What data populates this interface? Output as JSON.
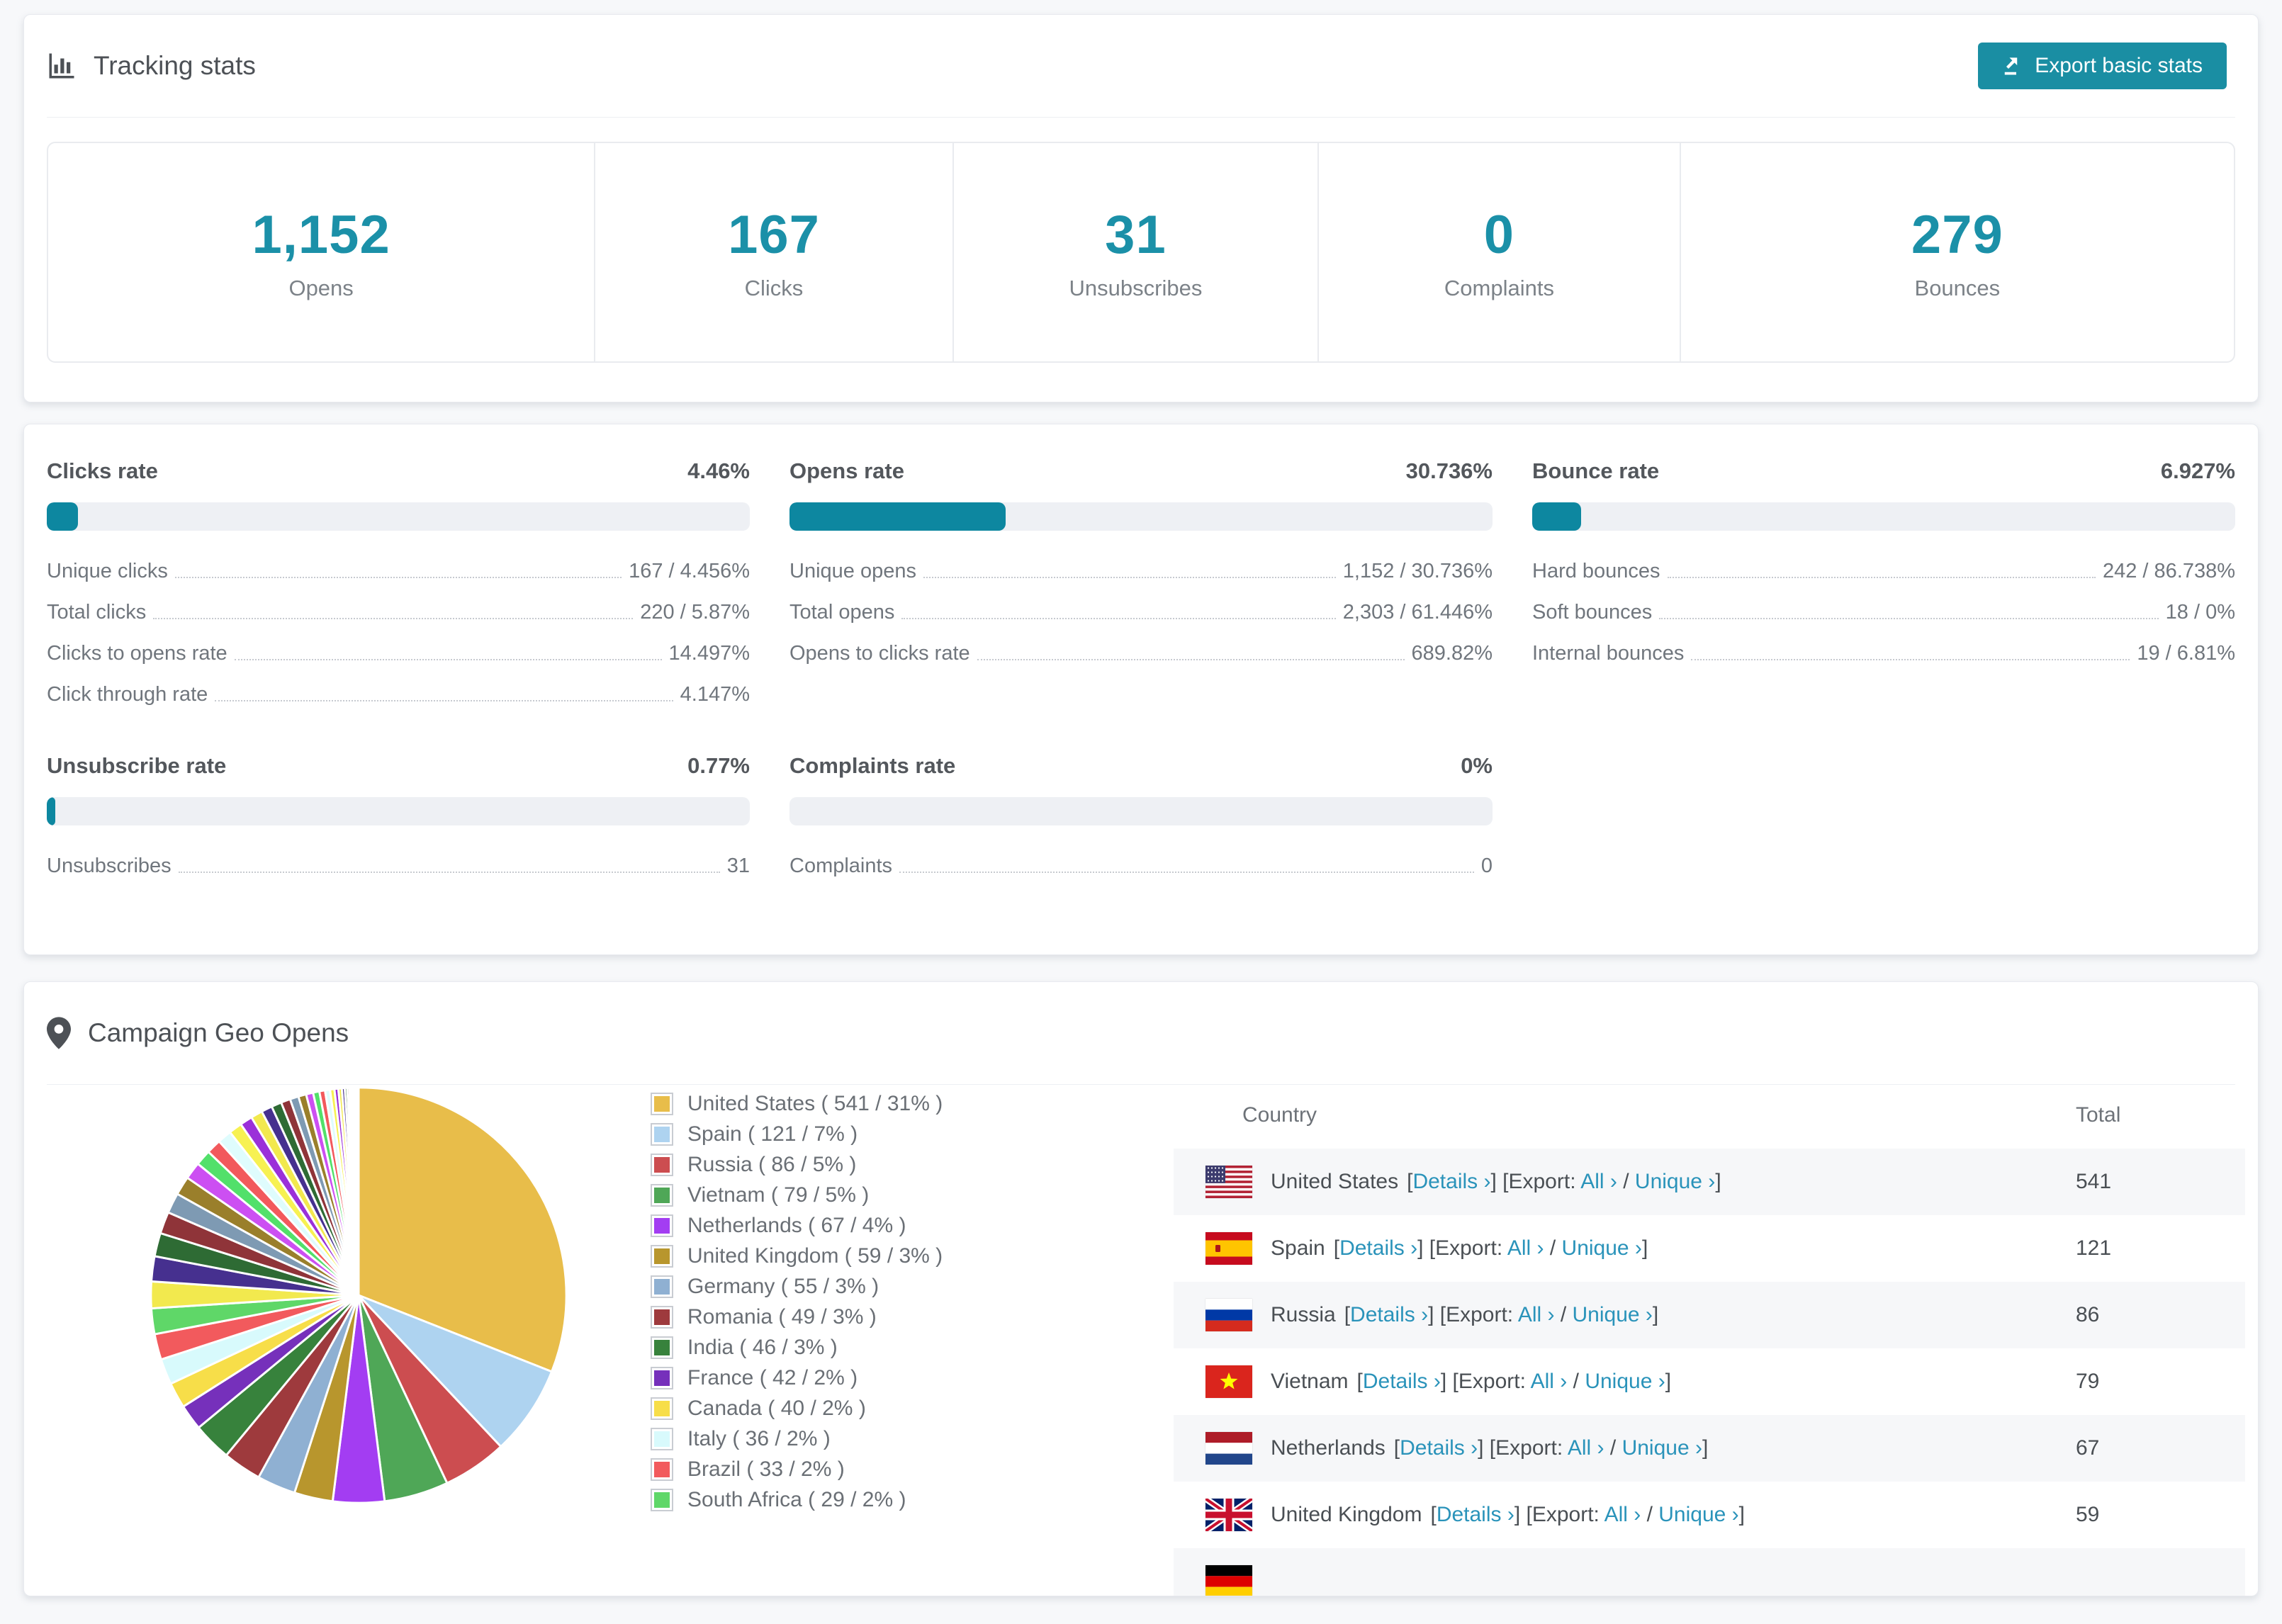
{
  "accent": "#1a8ea3",
  "link_color": "#2a93ba",
  "tracking": {
    "title": "Tracking stats",
    "export_button": "Export basic stats",
    "stats": [
      {
        "value": "1,152",
        "label": "Opens"
      },
      {
        "value": "167",
        "label": "Clicks"
      },
      {
        "value": "31",
        "label": "Unsubscribes"
      },
      {
        "value": "0",
        "label": "Complaints"
      },
      {
        "value": "279",
        "label": "Bounces"
      }
    ]
  },
  "rates": [
    {
      "title": "Clicks rate",
      "value": "4.46%",
      "bar_pct": 4.46,
      "rows": [
        {
          "label": "Unique clicks",
          "value": "167 / 4.456%"
        },
        {
          "label": "Total clicks",
          "value": "220 / 5.87%"
        },
        {
          "label": "Clicks to opens rate",
          "value": "14.497%"
        },
        {
          "label": "Click through rate",
          "value": "4.147%"
        }
      ]
    },
    {
      "title": "Opens rate",
      "value": "30.736%",
      "bar_pct": 30.736,
      "rows": [
        {
          "label": "Unique opens",
          "value": "1,152 / 30.736%"
        },
        {
          "label": "Total opens",
          "value": "2,303 / 61.446%"
        },
        {
          "label": "Opens to clicks rate",
          "value": "689.82%"
        }
      ]
    },
    {
      "title": "Bounce rate",
      "value": "6.927%",
      "bar_pct": 6.927,
      "rows": [
        {
          "label": "Hard bounces",
          "value": "242 / 86.738%"
        },
        {
          "label": "Soft bounces",
          "value": "18 / 0%"
        },
        {
          "label": "Internal bounces",
          "value": "19 / 6.81%"
        }
      ]
    },
    {
      "title": "Unsubscribe rate",
      "value": "0.77%",
      "bar_pct": 0.77,
      "rows": [
        {
          "label": "Unsubscribes",
          "value": "31"
        }
      ]
    },
    {
      "title": "Complaints rate",
      "value": "0%",
      "bar_pct": 0,
      "rows": [
        {
          "label": "Complaints",
          "value": "0"
        }
      ]
    }
  ],
  "geo": {
    "title": "Campaign Geo Opens",
    "table": {
      "columns": [
        "Country",
        "Total"
      ],
      "details_label": "Details ›",
      "export_label": "[Export:",
      "all_label": "All ›",
      "sep_label": "/",
      "unique_label": "Unique ›",
      "rows": [
        {
          "country": "United States",
          "flag": "us",
          "total": "541"
        },
        {
          "country": "Spain",
          "flag": "es",
          "total": "121"
        },
        {
          "country": "Russia",
          "flag": "ru",
          "total": "86"
        },
        {
          "country": "Vietnam",
          "flag": "vn",
          "total": "79"
        },
        {
          "country": "Netherlands",
          "flag": "nl",
          "total": "67"
        },
        {
          "country": "United Kingdom",
          "flag": "gb",
          "total": "59"
        },
        {
          "country": "",
          "flag": "de",
          "total": "",
          "partial": true
        }
      ]
    }
  },
  "chart_data": {
    "type": "pie",
    "title": "Campaign Geo Opens",
    "legend_position": "right",
    "slices": [
      {
        "name": "United States",
        "count": 541,
        "pct": 31,
        "color": "#e8bd4a",
        "legend": "United States ( 541 / 31% )"
      },
      {
        "name": "Spain",
        "count": 121,
        "pct": 7,
        "color": "#aed3f0",
        "legend": "Spain ( 121 / 7% )"
      },
      {
        "name": "Russia",
        "count": 86,
        "pct": 5,
        "color": "#cc4d50",
        "legend": "Russia ( 86 / 5% )"
      },
      {
        "name": "Vietnam",
        "count": 79,
        "pct": 5,
        "color": "#4fa757",
        "legend": "Vietnam ( 79 / 5% )"
      },
      {
        "name": "Netherlands",
        "count": 67,
        "pct": 4,
        "color": "#a33df2",
        "legend": "Netherlands ( 67 / 4% )"
      },
      {
        "name": "United Kingdom",
        "count": 59,
        "pct": 3,
        "color": "#b8962d",
        "legend": "United Kingdom ( 59 / 3% )"
      },
      {
        "name": "Germany",
        "count": 55,
        "pct": 3,
        "color": "#8fb0d2",
        "legend": "Germany ( 55 / 3% )"
      },
      {
        "name": "Romania",
        "count": 49,
        "pct": 3,
        "color": "#9e3a3d",
        "legend": "Romania ( 49 / 3% )"
      },
      {
        "name": "India",
        "count": 46,
        "pct": 3,
        "color": "#37823c",
        "legend": "India ( 46 / 3% )"
      },
      {
        "name": "France",
        "count": 42,
        "pct": 2,
        "color": "#7630bb",
        "legend": "France ( 42 / 2% )"
      },
      {
        "name": "Canada",
        "count": 40,
        "pct": 2,
        "color": "#f7de49",
        "legend": "Canada ( 40 / 2% )"
      },
      {
        "name": "Italy",
        "count": 36,
        "pct": 2,
        "color": "#d8fafc",
        "legend": "Italy ( 36 / 2% )"
      },
      {
        "name": "Brazil",
        "count": 33,
        "pct": 2,
        "color": "#f25a5d",
        "legend": "Brazil ( 33 / 2% )"
      },
      {
        "name": "South Africa",
        "count": 29,
        "pct": 2,
        "color": "#5fd768",
        "legend": "South Africa ( 29 / 2% )"
      }
    ],
    "tail_values": [
      2.07,
      1.95,
      1.82,
      1.7,
      1.58,
      1.46,
      1.34,
      1.22,
      1.15,
      1.09,
      1.03,
      0.97,
      0.91,
      0.85,
      0.79,
      0.73,
      0.67,
      0.61,
      0.55,
      0.49,
      0.44,
      0.39,
      0.34,
      0.3,
      0.27,
      0.23,
      0.19,
      0.17,
      0.15,
      0.12,
      0.1,
      0.09,
      0.07,
      0.06,
      0.05,
      0.04,
      0.02
    ],
    "tail_palette": [
      "#f2e94e",
      "#46308f",
      "#2e6b34",
      "#8f3439",
      "#7e9ab3",
      "#9a7f2b",
      "#cc4ff2",
      "#52e06a",
      "#f2595c",
      "#dffcfd",
      "#f7f152",
      "#9b30d9"
    ]
  }
}
